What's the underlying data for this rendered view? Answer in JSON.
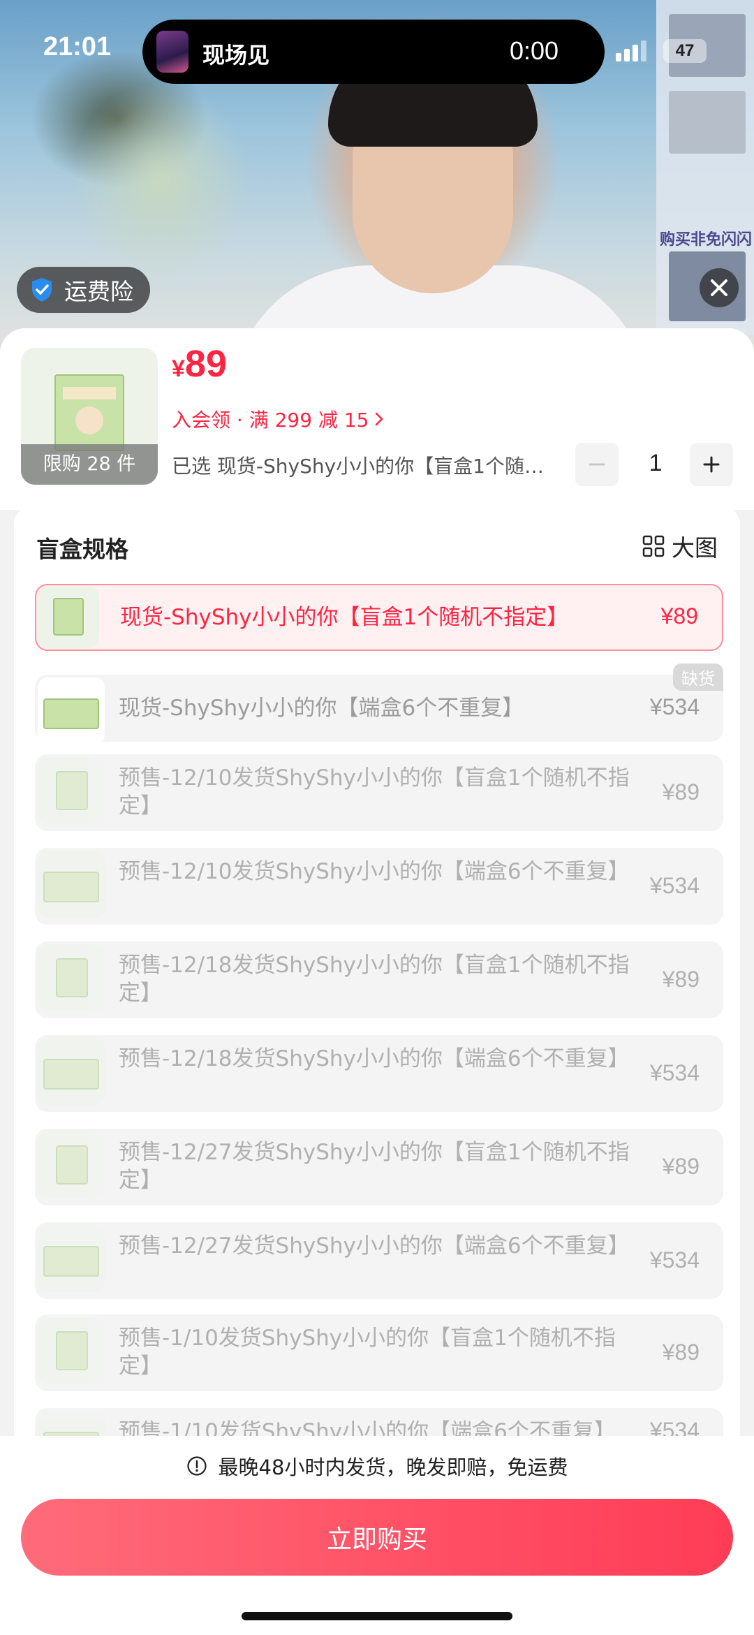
{
  "status_bar": {
    "time": "21:01",
    "battery": "47"
  },
  "live_island": {
    "title": "现场见",
    "timer": "0:00"
  },
  "video_overlay": {
    "insurance_label": "运费险",
    "side_banner": "购买非免闪闪"
  },
  "product": {
    "currency": "¥",
    "price": "89",
    "promo": "入会领 · 满 299 减 15",
    "limit": "限购 28 件",
    "selected": "已选 现货-ShyShy小小的你【盲盒1个随机不指定】",
    "quantity": "1"
  },
  "spec": {
    "title": "盲盒规格",
    "big_image_label": "大图",
    "out_of_stock_badge": "缺货",
    "options": [
      {
        "name": "现货-ShyShy小小的你【盲盒1个随机不指定】",
        "price": "¥89"
      },
      {
        "name": "现货-ShyShy小小的你【端盒6个不重复】",
        "price": "¥534"
      },
      {
        "name": "预售-12/10发货ShyShy小小的你【盲盒1个随机不指定】",
        "price": "¥89"
      },
      {
        "name": "预售-12/10发货ShyShy小小的你【端盒6个不重复】",
        "price": "¥534"
      },
      {
        "name": "预售-12/18发货ShyShy小小的你【盲盒1个随机不指定】",
        "price": "¥89"
      },
      {
        "name": "预售-12/18发货ShyShy小小的你【端盒6个不重复】",
        "price": "¥534"
      },
      {
        "name": "预售-12/27发货ShyShy小小的你【盲盒1个随机不指定】",
        "price": "¥89"
      },
      {
        "name": "预售-12/27发货ShyShy小小的你【端盒6个不重复】",
        "price": "¥534"
      },
      {
        "name": "预售-1/10发货ShyShy小小的你【盲盒1个随机不指定】",
        "price": "¥89"
      },
      {
        "name": "预售-1/10发货ShyShy小小的你【端盒6个不重复】",
        "price": "¥534"
      }
    ]
  },
  "footer": {
    "shipping_note": "最晚48小时内发货，晚发即赔，免运费",
    "buy_label": "立即购买"
  },
  "colors": {
    "accent": "#ff2442",
    "button": "#ff3c56"
  },
  "icons": [
    "shield-check-icon",
    "close-icon",
    "chevron-right-icon",
    "minus-icon",
    "plus-icon",
    "grid-icon",
    "info-icon"
  ]
}
